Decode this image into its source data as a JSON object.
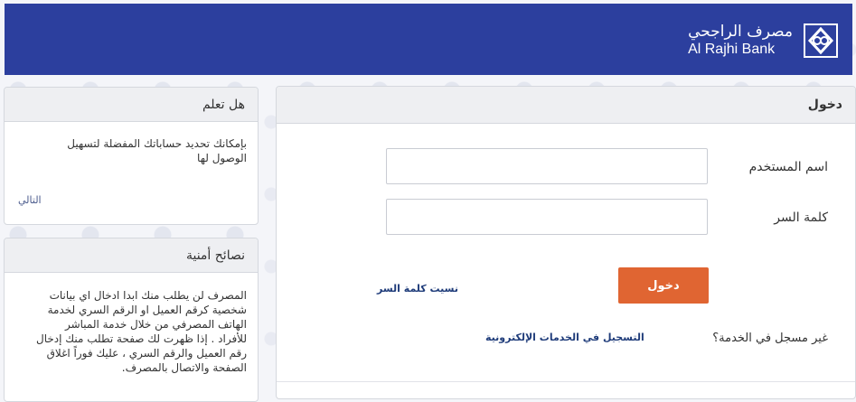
{
  "header": {
    "logo_ar": "مصرف الراجحي",
    "logo_en": "Al Rajhi Bank"
  },
  "login": {
    "title": "دخول",
    "username_label": "اسم المستخدم",
    "password_label": "كلمة السر",
    "username_value": "",
    "password_value": "",
    "login_button": "دخول",
    "forgot_password": "نسيت كلمة السر",
    "not_registered": "غير مسجل في الخدمة؟",
    "register_link": "التسجيل في الخدمات الإلكترونية"
  },
  "did_you_know": {
    "title": "هل تعلم",
    "text": "بإمكانك تحديد حساباتك المفضلة لتسهيل الوصول لها",
    "next_link": "التالي"
  },
  "security_tips": {
    "title": "نصائح أمنية",
    "text": "المصرف لن يطلب منك ابدا ادخال اي بيانات شخصية كرقم العميل او الرقم السري لخدمة الهاتف المصرفي من خلال خدمة المباشر للأفراد . إذا ظهرت لك صفحة تطلب منك إدخال رقم العميل والرقم السري ، عليك فوراً اغلاق الصفحة والاتصال بالمصرف."
  },
  "colors": {
    "header_bg": "#2c3f9e",
    "button_bg": "#e06532",
    "link": "#1f3c7a"
  }
}
